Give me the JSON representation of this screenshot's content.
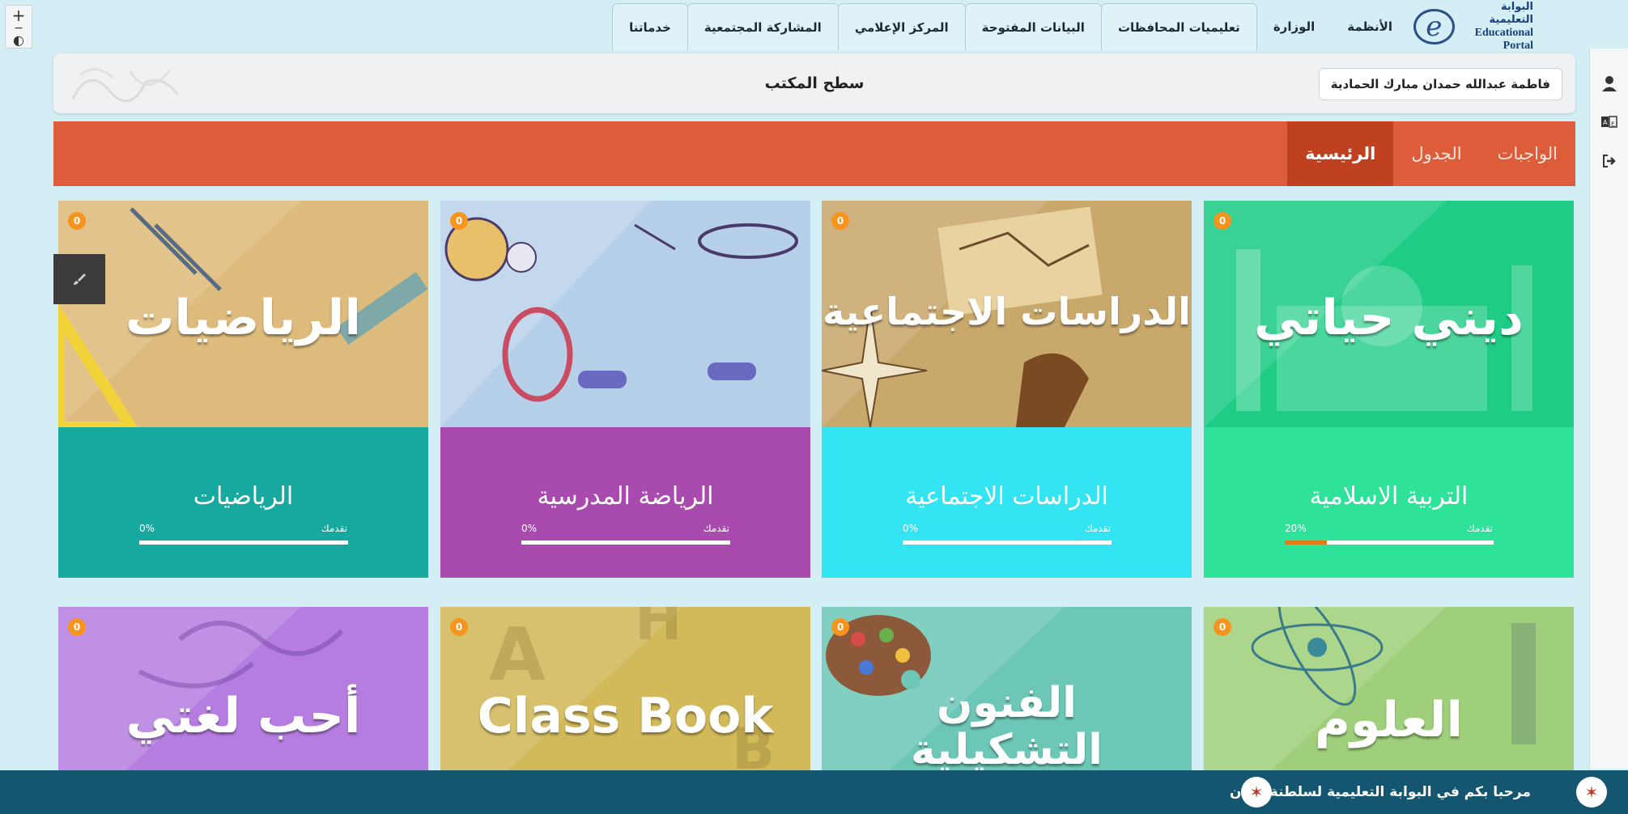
{
  "left_tools": {
    "plus": "+",
    "minus": "−",
    "contrast": "◐"
  },
  "nav": {
    "logo_ar": "البوابة التعليمية",
    "logo_en": "Educational Portal",
    "tabs": [
      "الأنظمة",
      "الوزارة",
      "تعليميات المحافظات",
      "البيانات المفتوحة",
      "المركز الإعلامي",
      "المشاركة المجتمعية",
      "خدماتنا"
    ]
  },
  "header": {
    "title": "سطح المكتب",
    "user_name": "فاطمة عبدالله حمدان مبارك الحمادية"
  },
  "menu": {
    "items": [
      "الرئيسية",
      "الجدول",
      "الواجبات"
    ],
    "active_index": 0
  },
  "courses": [
    {
      "banner": "ديني حياتي",
      "name": "التربية الاسلامية",
      "progress_label": "تقدمك",
      "progress_text": "20%",
      "progress": 0.2,
      "badge": "0",
      "img_color": "#1fcc86",
      "info_color": "#2ee29a"
    },
    {
      "banner": "الدراسات الاجتماعية",
      "name": "الدراسات الاجتماعية",
      "progress_label": "تقدمك",
      "progress_text": "0%",
      "progress": 0,
      "badge": "0",
      "img_color": "#c9a86b",
      "info_color": "#33e4f2"
    },
    {
      "banner": "",
      "name": "الرياضة المدرسية",
      "progress_label": "تقدمك",
      "progress_text": "0%",
      "progress": 0,
      "badge": "0",
      "img_color": "#b6d0ea",
      "info_color": "#a94aae"
    },
    {
      "banner": "الرياضيات",
      "name": "الرياضيات",
      "progress_label": "تقدمك",
      "progress_text": "0%",
      "progress": 0,
      "badge": "0",
      "img_color": "#ddbb7c",
      "info_color": "#17a8a0"
    },
    {
      "banner": "العلوم",
      "name": "",
      "progress_label": "",
      "progress_text": "",
      "progress": null,
      "badge": "0",
      "img_color": "#9fcf7a",
      "info_color": "#9fcf7a"
    },
    {
      "banner": "الفنون التشكيلية",
      "name": "",
      "progress_label": "",
      "progress_text": "",
      "progress": null,
      "badge": "0",
      "img_color": "#6cc7b7",
      "info_color": "#6cc7b7"
    },
    {
      "banner": "Class Book",
      "name": "",
      "progress_label": "",
      "progress_text": "",
      "progress": null,
      "badge": "0",
      "img_color": "#d2b95a",
      "info_color": "#d2b95a"
    },
    {
      "banner": "أحب لغتي",
      "name": "",
      "progress_label": "",
      "progress_text": "",
      "progress": null,
      "badge": "0",
      "img_color": "#b57de0",
      "info_color": "#b57de0"
    }
  ],
  "footer": {
    "welcome": "مرحبا بكم في البوابة التعليمية لسلطنة عمان"
  }
}
